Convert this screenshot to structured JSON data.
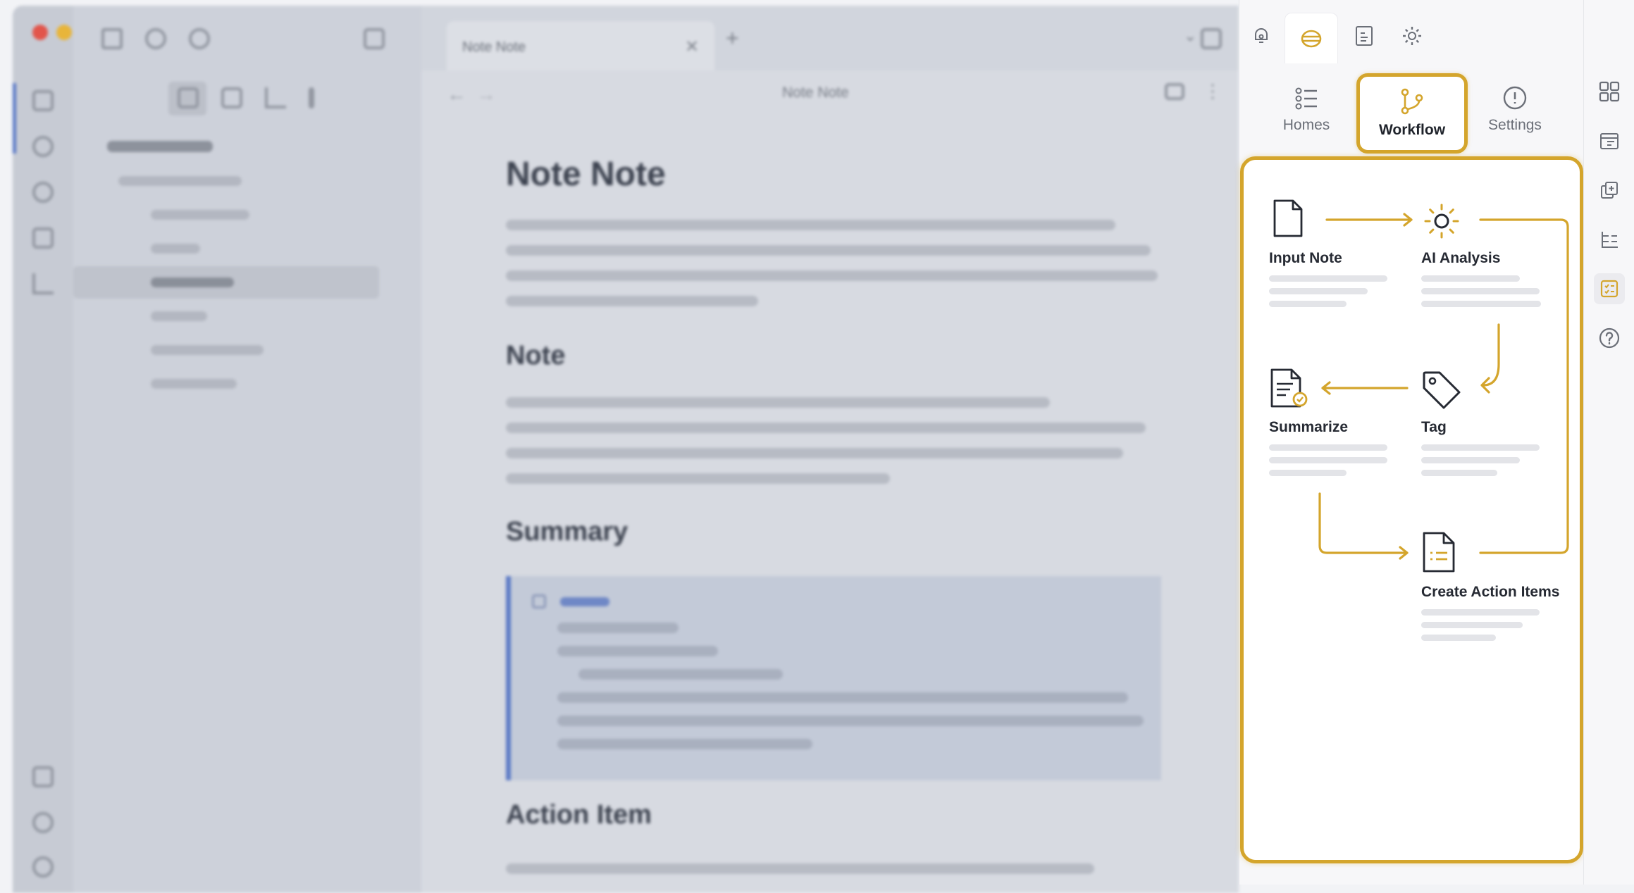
{
  "window": {
    "tab_title": "Note Note",
    "doc_title": "Note Note",
    "headings": {
      "h1": "Note Note",
      "h2": "Note",
      "h3": "Summary",
      "h4": "Action Item"
    }
  },
  "panel": {
    "nav": [
      {
        "label": "Homes",
        "icon": "list-icon"
      },
      {
        "label": "Workflow",
        "icon": "branch-icon"
      },
      {
        "label": "Settings",
        "icon": "info-circle-icon"
      }
    ],
    "workflow_nodes": {
      "input_note": "Input Note",
      "ai_analysis": "AI Analysis",
      "summarize": "Summarize",
      "tag": "Tag",
      "create_action_items": "Create Action Items"
    }
  },
  "colors": {
    "accent": "#d4a52c",
    "summary_border": "#5d7bc6"
  }
}
